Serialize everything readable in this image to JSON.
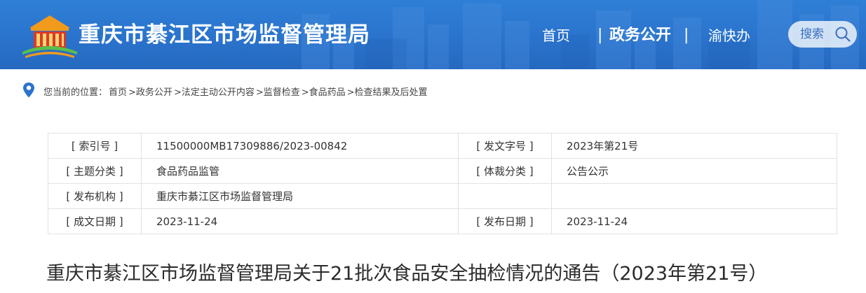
{
  "header": {
    "site_title": "重庆市綦江区市场监督管理局",
    "nav": {
      "home": "首页",
      "separator": "|",
      "gov_open": "政务公开",
      "yukuaiban": "渝快办"
    },
    "search_label": "搜索",
    "colors": {
      "bar": "#2a73cc",
      "accent_orange": "#f29a1c",
      "accent_red": "#d93a2b"
    }
  },
  "breadcrumb": {
    "prefix": "您当前的位置：",
    "items": [
      "首页",
      ">政务公开",
      ">法定主动公开内容",
      ">监督检查",
      ">食品药品",
      ">检查结果及后处置"
    ]
  },
  "meta_table": {
    "rows": [
      {
        "k1": "[ 索引号 ]",
        "v1": "11500000MB17309886/2023-00842",
        "k2": "[ 发文字号 ]",
        "v2": "2023年第21号"
      },
      {
        "k1": "[ 主题分类 ]",
        "v1": "食品药品监管",
        "k2": "[ 体裁分类 ]",
        "v2": "公告公示"
      },
      {
        "k1": "[ 发布机构 ]",
        "v1": "重庆市綦江区市场监督管理局",
        "k2": "",
        "v2": ""
      },
      {
        "k1": "[ 成文日期 ]",
        "v1": "2023-11-24",
        "k2": "[ 发布日期 ]",
        "v2": "2023-11-24"
      }
    ]
  },
  "article": {
    "title": "重庆市綦江区市场监督管理局关于21批次食品安全抽检情况的通告（2023年第21号）"
  }
}
